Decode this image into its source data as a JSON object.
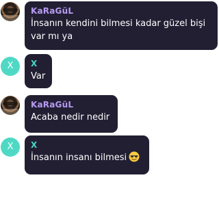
{
  "messages": [
    {
      "sender": "KaRaGüL",
      "avatar": "user-photo",
      "text": "İnsanın kendini bilmesi kadar güzel bişi var mı ya"
    },
    {
      "sender": "X",
      "avatar_letter": "X",
      "text": "Var"
    },
    {
      "sender": "KaRaGüL",
      "avatar": "user-photo",
      "text": "Acaba nedir nedir"
    },
    {
      "sender": "X",
      "avatar_letter": "X",
      "text": "İnsanın insanı bilmesi",
      "emoji": "smiling-face-with-sunglasses-icon"
    }
  ],
  "colors": {
    "bubble": "#221f33",
    "sender_a": "#b79cf2",
    "sender_b": "#45d8c3",
    "avatar_b": "#4fd9c5",
    "message_text": "#ffffff"
  }
}
